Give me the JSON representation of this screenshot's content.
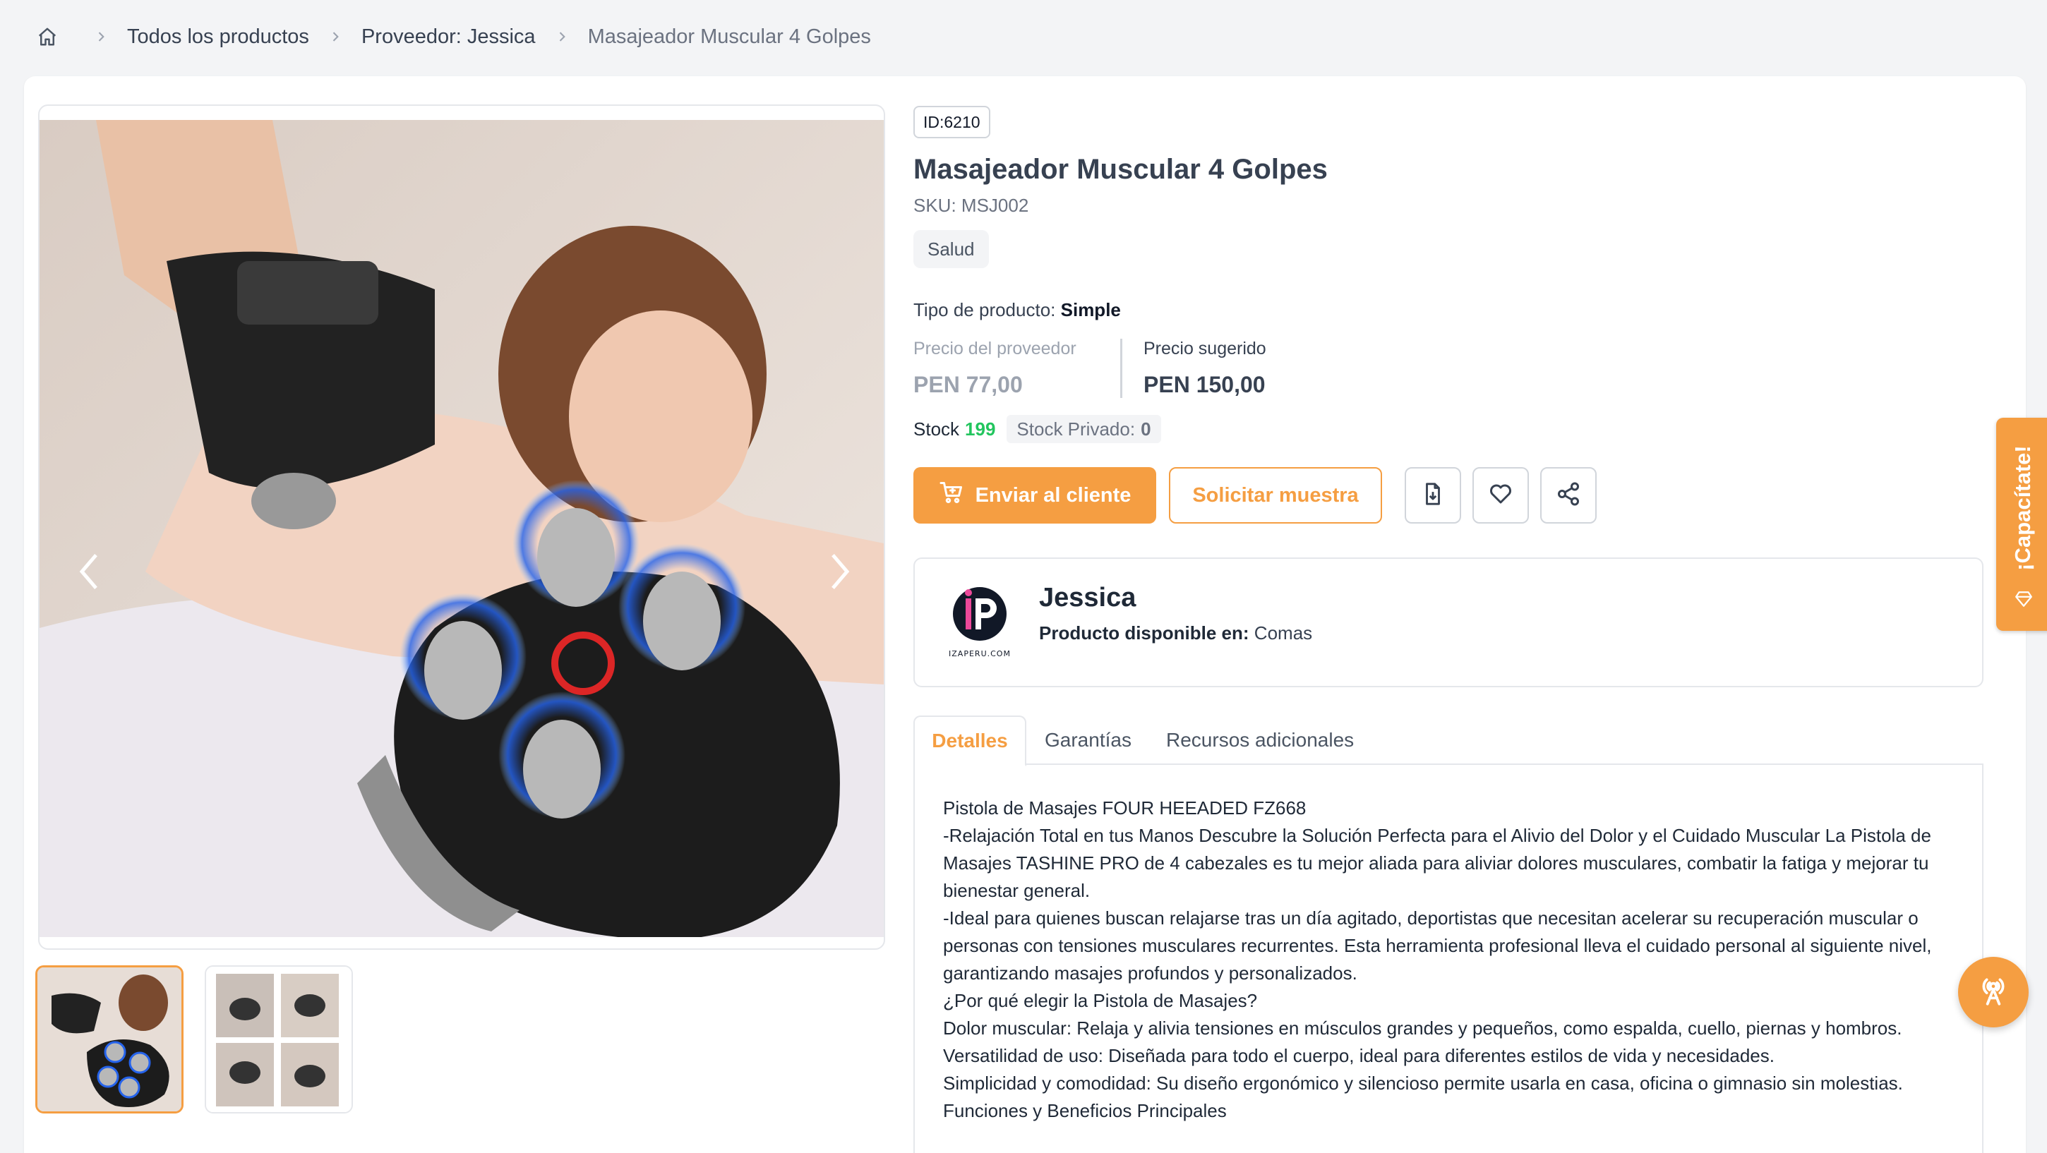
{
  "breadcrumb": {
    "items": [
      "Todos los productos",
      "Proveedor: Jessica",
      "Masajeador Muscular 4 Golpes"
    ]
  },
  "product": {
    "id_label": "ID:6210",
    "title": "Masajeador Muscular 4 Golpes",
    "sku": "SKU: MSJ002",
    "category": "Salud",
    "type_label": "Tipo de producto:",
    "type_value": "Simple",
    "provider_price_label": "Precio del proveedor",
    "provider_price": "PEN 77,00",
    "suggested_price_label": "Precio sugerido",
    "suggested_price": "PEN 150,00",
    "stock_label": "Stock",
    "stock_value": "199",
    "private_stock_label": "Stock Privado:",
    "private_stock_value": "0"
  },
  "actions": {
    "send_label": "Enviar al cliente",
    "sample_label": "Solicitar muestra"
  },
  "supplier": {
    "name": "Jessica",
    "logo_text": "IZAPERU.COM",
    "availability_label": "Producto disponible en:",
    "availability_value": "Comas"
  },
  "tabs": [
    "Detalles",
    "Garantías",
    "Recursos adicionales"
  ],
  "details": [
    "Pistola de Masajes FOUR HEEADED FZ668",
    "-Relajación Total en tus Manos Descubre la Solución Perfecta para el Alivio del Dolor y el Cuidado Muscular La Pistola de Masajes TASHINE PRO de 4 cabezales es tu mejor aliada para aliviar dolores musculares, combatir la fatiga y mejorar tu bienestar general.",
    "-Ideal para quienes buscan relajarse tras un día agitado, deportistas que necesitan acelerar su recuperación muscular o personas con tensiones musculares recurrentes. Esta herramienta profesional lleva el cuidado personal al siguiente nivel, garantizando masajes profundos y personalizados.",
    "¿Por qué elegir la Pistola de Masajes?",
    "Dolor muscular: Relaja y alivia tensiones en músculos grandes y pequeños, como espalda, cuello, piernas y hombros. Versatilidad de uso: Diseñada para todo el cuerpo, ideal para diferentes estilos de vida y necesidades.",
    "Simplicidad y comodidad: Su diseño ergonómico y silencioso permite usarla en casa, oficina o gimnasio sin molestias.",
    "Funciones y Beneficios Principales"
  ],
  "side_tab": {
    "label": "¡Capacítate!"
  },
  "colors": {
    "accent": "#f59e42",
    "stock_green": "#22c55e"
  },
  "icons": [
    "home-icon",
    "chevron-right-icon",
    "chevron-left-icon",
    "cart-icon",
    "download-file-icon",
    "heart-icon",
    "share-icon",
    "broadcast-icon",
    "gem-icon"
  ]
}
